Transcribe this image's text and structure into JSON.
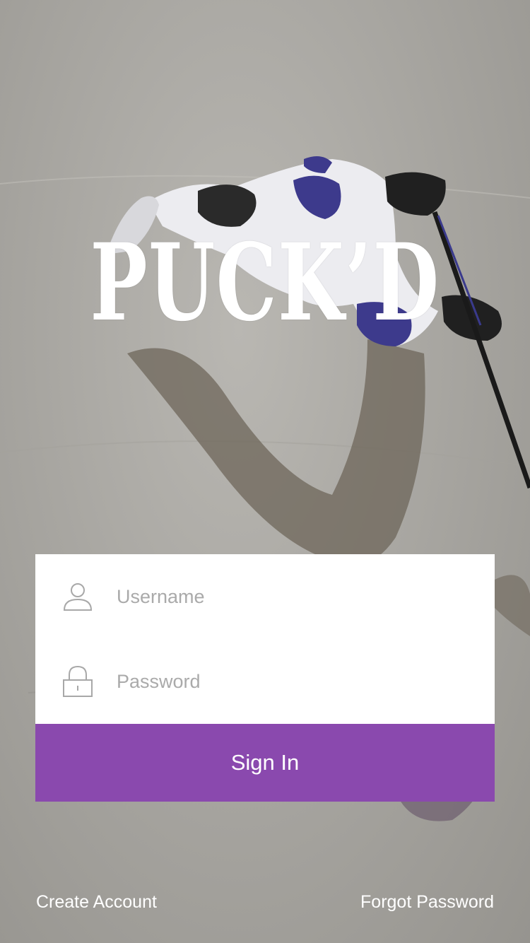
{
  "app": {
    "logo_text": "PUCK’D"
  },
  "login": {
    "username_placeholder": "Username",
    "username_value": "",
    "password_placeholder": "Password",
    "password_value": "",
    "signin_label": "Sign In"
  },
  "footer": {
    "create_account_label": "Create Account",
    "forgot_password_label": "Forgot Password"
  },
  "icons": {
    "username": "user-icon",
    "password": "lock-icon"
  },
  "colors": {
    "accent": "#8a49ae",
    "card_background": "#ffffff",
    "placeholder": "#aaaaaa"
  }
}
